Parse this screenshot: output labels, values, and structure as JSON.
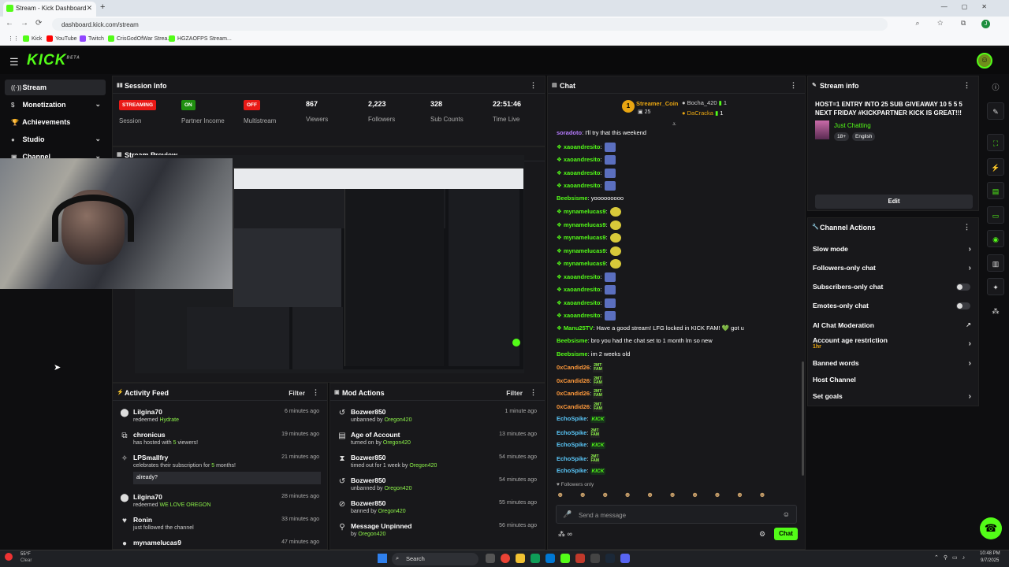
{
  "browser": {
    "tab_title": "Stream - Kick Dashboard",
    "url": "dashboard.kick.com/stream",
    "profile_initial": "J",
    "bookmarks": [
      "Kick",
      "YouTube",
      "Twitch",
      "CrisGodOfWar Strea...",
      "HGZAOFPS Stream..."
    ]
  },
  "app": {
    "logo": "KICK",
    "logo_sup": "BETA"
  },
  "sidebar": {
    "items": [
      {
        "label": "Stream",
        "icon": "stream-icon",
        "active": true
      },
      {
        "label": "Monetization",
        "icon": "dollar-icon",
        "chevron": true
      },
      {
        "label": "Achievements",
        "icon": "trophy-icon"
      },
      {
        "label": "Studio",
        "icon": "studio-icon",
        "chevron": true
      },
      {
        "label": "Channel",
        "icon": "channel-icon",
        "chevron": true
      }
    ]
  },
  "session": {
    "title": "Session Info",
    "streaming_badge": "STREAMING",
    "session_label": "Session",
    "partner_badge": "ON",
    "partner_label": "Partner Income",
    "multistream_badge": "OFF",
    "multistream_label": "Multistream",
    "viewers": "867",
    "viewers_label": "Viewers",
    "followers": "2,223",
    "followers_label": "Followers",
    "subs": "328",
    "subs_label": "Sub Counts",
    "time_live": "22:51:46",
    "time_live_label": "Time Live"
  },
  "preview": {
    "title": "Stream Preview"
  },
  "activity": {
    "title": "Activity Feed",
    "filter": "Filter",
    "items": [
      {
        "name": "Lilgina70",
        "pre": "redeemed ",
        "hl": "Hydrate",
        "post": "",
        "time": "6 minutes ago"
      },
      {
        "name": "chronicus",
        "pre": "has hosted with ",
        "hl": "5",
        "post": " viewers!",
        "time": "19 minutes ago"
      },
      {
        "name": "LPSmallfry",
        "pre": "celebrates their subscription for ",
        "hl": "5",
        "post": " months!",
        "time": "21 minutes ago",
        "quote": "already?"
      },
      {
        "name": "Lilgina70",
        "pre": "redeemed ",
        "hl": "WE LOVE OREGON",
        "post": "",
        "time": "28 minutes ago"
      },
      {
        "name": "Ronin",
        "pre": "just followed the channel",
        "hl": "",
        "post": "",
        "time": "33 minutes ago"
      },
      {
        "name": "mynamelucas9",
        "pre": "",
        "hl": "",
        "post": "",
        "time": "47 minutes ago"
      }
    ]
  },
  "mod": {
    "title": "Mod Actions",
    "filter": "Filter",
    "items": [
      {
        "name": "Bozwer850",
        "pre": "unbanned by ",
        "hl": "Oregon420",
        "time": "1 minute ago"
      },
      {
        "name": "Age of Account",
        "pre": "turned on by ",
        "hl": "Oregon420",
        "time": "13 minutes ago"
      },
      {
        "name": "Bozwer850",
        "pre": "timed out for 1 week by ",
        "hl": "Oregon420",
        "time": "54 minutes ago"
      },
      {
        "name": "Bozwer850",
        "pre": "unbanned by ",
        "hl": "Oregon420",
        "time": "54 minutes ago"
      },
      {
        "name": "Bozwer850",
        "pre": "banned by ",
        "hl": "Oregon420",
        "time": "55 minutes ago"
      },
      {
        "name": "Message Unpinned",
        "pre": "by ",
        "hl": "Oregon420",
        "time": "56 minutes ago"
      }
    ]
  },
  "chat": {
    "title": "Chat",
    "top_gifter": "Streamer_Coin",
    "top_gifter_count": "25",
    "gifter2": "Bocha_420",
    "gifter2_count": "1",
    "gifter3": "DaCracka",
    "gifter3_count": "1",
    "messages": [
      {
        "user": "soradoto",
        "color": "#b77cff",
        "text": "I'll try that this weekend",
        "badge": false
      },
      {
        "user": "xaoandresito",
        "color": "#53fc18",
        "text": "",
        "badge": true,
        "emote": "e1"
      },
      {
        "user": "xaoandresito",
        "color": "#53fc18",
        "text": "",
        "badge": true,
        "emote": "e1"
      },
      {
        "user": "xaoandresito",
        "color": "#53fc18",
        "text": "",
        "badge": true,
        "emote": "e1"
      },
      {
        "user": "xaoandresito",
        "color": "#53fc18",
        "text": "",
        "badge": true,
        "emote": "e1"
      },
      {
        "user": "Beebsisme",
        "color": "#53fc18",
        "text": "yooooooooo",
        "badge": false
      },
      {
        "user": "mynamelucas9",
        "color": "#53fc18",
        "text": "",
        "badge": true,
        "emote": "e2"
      },
      {
        "user": "mynamelucas9",
        "color": "#53fc18",
        "text": "",
        "badge": true,
        "emote": "e2"
      },
      {
        "user": "mynamelucas9",
        "color": "#53fc18",
        "text": "",
        "badge": true,
        "emote": "e2"
      },
      {
        "user": "mynamelucas9",
        "color": "#53fc18",
        "text": "",
        "badge": true,
        "emote": "e2"
      },
      {
        "user": "mynamelucas9",
        "color": "#53fc18",
        "text": "",
        "badge": true,
        "emote": "e2"
      },
      {
        "user": "xaoandresito",
        "color": "#53fc18",
        "text": "",
        "badge": true,
        "emote": "e1"
      },
      {
        "user": "xaoandresito",
        "color": "#53fc18",
        "text": "",
        "badge": true,
        "emote": "e1"
      },
      {
        "user": "xaoandresito",
        "color": "#53fc18",
        "text": "",
        "badge": true,
        "emote": "e1"
      },
      {
        "user": "xaoandresito",
        "color": "#53fc18",
        "text": "",
        "badge": true,
        "emote": "e1"
      },
      {
        "user": "Manu25TV",
        "color": "#53fc18",
        "text": "Have a good stream! LFG locked in KICK FAM! 💚 got u",
        "badge": true
      },
      {
        "user": "Beebsisme",
        "color": "#53fc18",
        "text": "bro you had the chat set to 1 month lm so new",
        "badge": false
      },
      {
        "user": "Beebsisme",
        "color": "#53fc18",
        "text": "im 2 weeks old",
        "badge": false
      },
      {
        "user": "0xCandid26",
        "color": "#ff9a3c",
        "text": "",
        "badge": false,
        "emote": "fam"
      },
      {
        "user": "0xCandid26",
        "color": "#ff9a3c",
        "text": "",
        "badge": false,
        "emote": "fam"
      },
      {
        "user": "0xCandid26",
        "color": "#ff9a3c",
        "text": "",
        "badge": false,
        "emote": "fam"
      },
      {
        "user": "0xCandid26",
        "color": "#ff9a3c",
        "text": "",
        "badge": false,
        "emote": "fam"
      },
      {
        "user": "EchoSpike",
        "color": "#5ac8fa",
        "text": "",
        "badge": false,
        "emote": "kick"
      },
      {
        "user": "EchoSpike",
        "color": "#5ac8fa",
        "text": "",
        "badge": false,
        "emote": "fam"
      },
      {
        "user": "EchoSpike",
        "color": "#5ac8fa",
        "text": "",
        "badge": false,
        "emote": "kick"
      },
      {
        "user": "EchoSpike",
        "color": "#5ac8fa",
        "text": "",
        "badge": false,
        "emote": "fam"
      },
      {
        "user": "EchoSpike",
        "color": "#5ac8fa",
        "text": "",
        "badge": false,
        "emote": "kick"
      }
    ],
    "emote_fam_line1": "2MT",
    "emote_fam_line2": "FAM",
    "emote_kick": "KICK",
    "followers_only": "Followers only",
    "input_placeholder": "Send a message",
    "send_label": "Chat"
  },
  "stream_info": {
    "title": "Stream info",
    "stream_title": "HOST=1 ENTRY INTO 25 SUB GIVEAWAY 10 5 5 5 NEXT FRIDAY #KICKPARTNER KICK IS GREAT!!!",
    "category": "Just Chatting",
    "tag1": "18+",
    "tag2": "English",
    "edit_label": "Edit"
  },
  "channel_actions": {
    "title": "Channel Actions",
    "slow_mode": "Slow mode",
    "followers_only": "Followers-only chat",
    "subscribers_only": "Subscribers-only chat",
    "emotes_only": "Emotes-only chat",
    "ai_mod": "AI Chat Moderation",
    "age_restriction": "Account age restriction",
    "age_value": "1hr",
    "banned_words": "Banned words",
    "host_channel": "Host Channel",
    "set_goals": "Set goals"
  },
  "taskbar": {
    "weather_temp": "55°F",
    "weather_desc": "Clear",
    "search": "Search",
    "time": "10:48 PM",
    "date": "9/7/2025"
  },
  "colors": {
    "accent": "#53fc18",
    "streaming": "#e91916",
    "panel": "#18181b"
  }
}
